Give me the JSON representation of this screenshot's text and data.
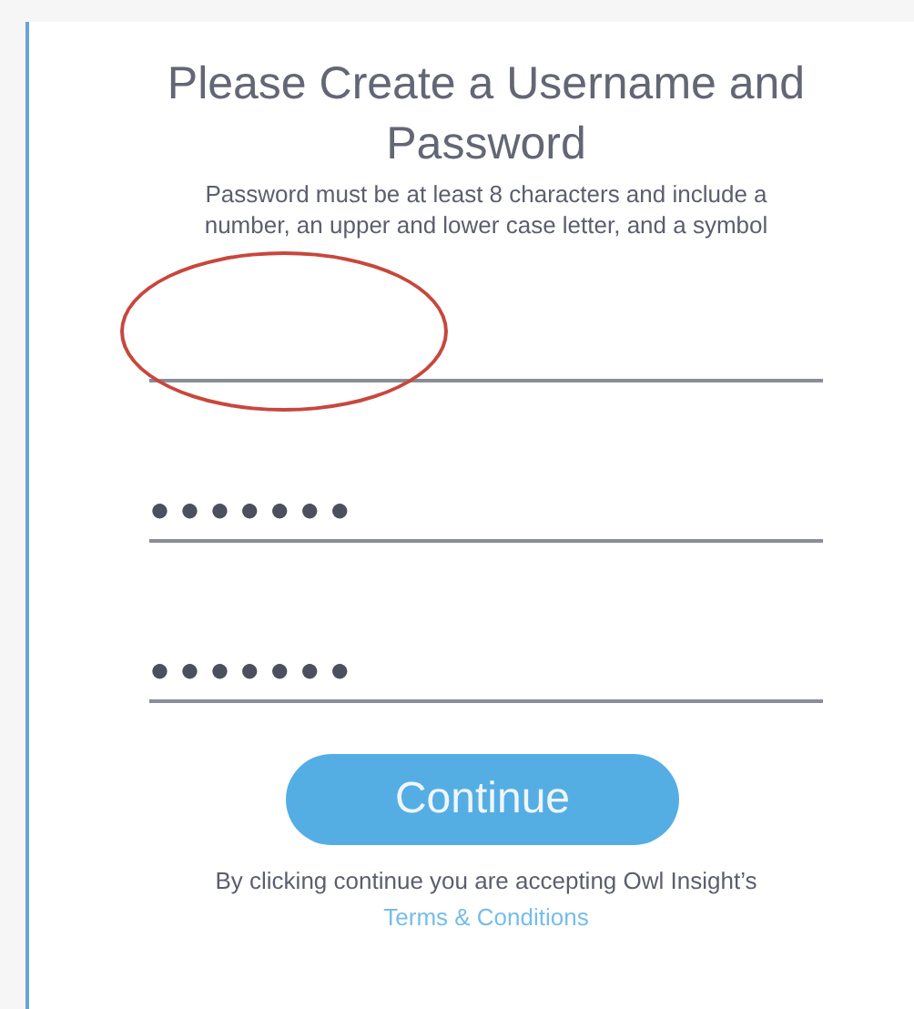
{
  "title": "Please Create a Username and Password",
  "hint": "Password must be at least 8 characters and include a number, an upper and lower case letter, and a symbol",
  "fields": [
    {
      "kind": "username",
      "highlighted": true
    },
    {
      "kind": "password",
      "value": "●●●●●●●",
      "highlighted": false
    },
    {
      "kind": "password",
      "value": "●●●●●●●",
      "highlighted": false
    }
  ],
  "button": "Continue",
  "footer": {
    "text": "By clicking continue you are accepting Owl Insight’s",
    "link": "Terms & Conditions"
  }
}
